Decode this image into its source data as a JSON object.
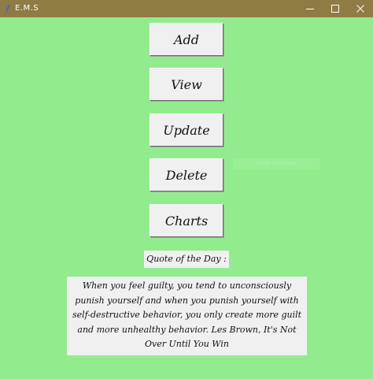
{
  "window": {
    "title": "E.M.S"
  },
  "menu": {
    "add_label": "Add",
    "view_label": "View",
    "update_label": "Update",
    "delete_label": "Delete",
    "charts_label": "Charts"
  },
  "faded_label": "Quote of the Day",
  "quote": {
    "title": "Quote of the Day :",
    "text": "When you feel guilty, you tend to unconsciously punish yourself and when you punish yourself with self-destructive behavior, you only create more guilt and more unhealthy behavior. Les Brown, It's Not Over Until You Win"
  },
  "colors": {
    "titlebar": "#8f7b44",
    "background": "#92ec8e",
    "button_face": "#f0f0f0"
  },
  "icons": {
    "app": "feather-icon",
    "minimize": "minimize-icon",
    "maximize": "maximize-icon",
    "close": "close-icon"
  }
}
